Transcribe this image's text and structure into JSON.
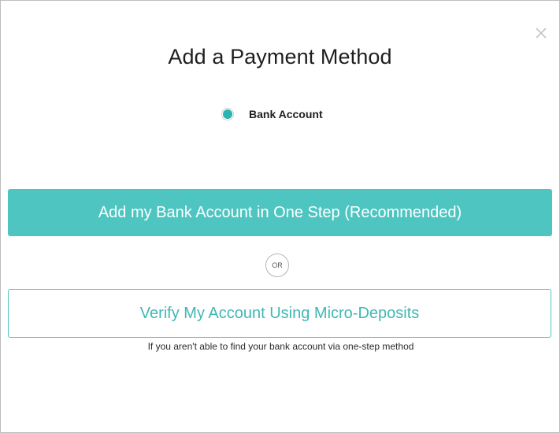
{
  "modal": {
    "title": "Add a Payment Method",
    "close_icon": "close-icon",
    "payment_option": {
      "label": "Bank Account",
      "selected": true
    },
    "primary_button_label": "Add my Bank Account in One Step (Recommended)",
    "divider_label": "OR",
    "secondary_button_label": "Verify My Account Using Micro-Deposits",
    "helper_text": "If you aren't able to find your bank account via one-step method"
  },
  "colors": {
    "accent": "#4ec5c1",
    "radio_selected": "#29b3b1",
    "secondary_text": "#3fb8b4"
  }
}
